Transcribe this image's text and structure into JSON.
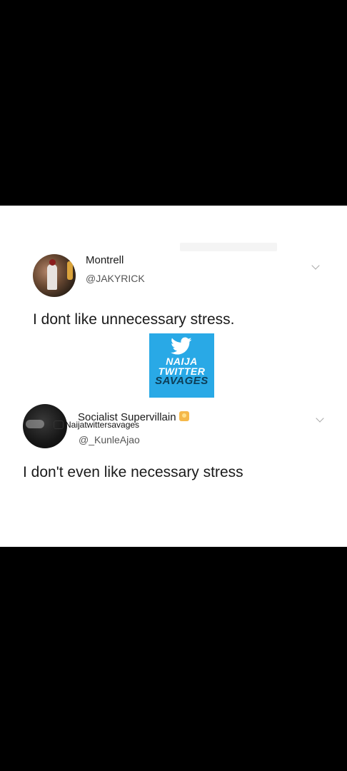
{
  "tweets": [
    {
      "display_name": "Montrell",
      "handle": "@JAKYRICK",
      "text": "I dont like unnecessary stress."
    },
    {
      "display_name": "Socialist Supervillain",
      "handle": "@_KunleAjao",
      "text": "I don't even like necessary stress"
    }
  ],
  "logo": {
    "line1": "NAIJA",
    "line2": "TWITTER",
    "line3": "SAVAGES",
    "background": "#29a9e6"
  },
  "watermark": {
    "text": "Naijatwittersavages"
  },
  "icons": {
    "chevron": "chevron-down-icon",
    "bird": "twitter-bird-icon",
    "verified": "emoji-badge-icon",
    "instagram": "instagram-icon"
  }
}
